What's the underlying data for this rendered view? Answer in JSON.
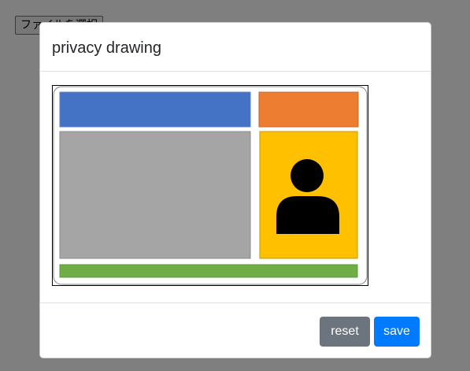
{
  "page": {
    "file_button_label": "ファイルを選択"
  },
  "modal": {
    "title": "privacy drawing",
    "reset_label": "reset",
    "save_label": "save"
  },
  "drawing": {
    "colors": {
      "header_block": "#4472c4",
      "corner_block": "#ed7d31",
      "content_block": "#a5a5a5",
      "photo_block": "#ffc000",
      "footer_block": "#70ad47",
      "person": "#000000"
    },
    "icons": [
      "person-icon"
    ]
  },
  "colors": {
    "reset_button": "#6c757d",
    "save_button": "#007bff",
    "backdrop": "rgba(0,0,0,0.5)"
  }
}
